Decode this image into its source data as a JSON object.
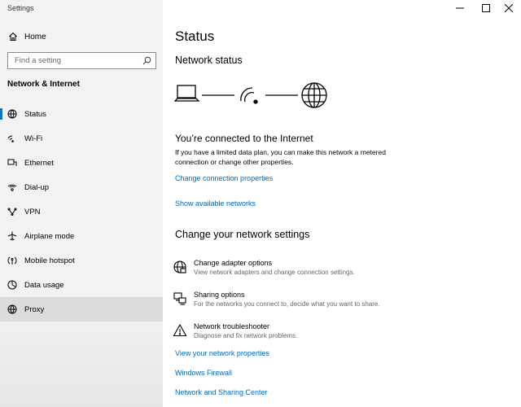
{
  "app": {
    "title": "Settings"
  },
  "sidebar": {
    "home_label": "Home",
    "search_placeholder": "Find a setting",
    "section_title": "Network & Internet",
    "items": [
      {
        "label": "Status",
        "icon": "status-icon"
      },
      {
        "label": "Wi-Fi",
        "icon": "wifi-icon"
      },
      {
        "label": "Ethernet",
        "icon": "ethernet-icon"
      },
      {
        "label": "Dial-up",
        "icon": "dialup-icon"
      },
      {
        "label": "VPN",
        "icon": "vpn-icon"
      },
      {
        "label": "Airplane mode",
        "icon": "airplane-icon"
      },
      {
        "label": "Mobile hotspot",
        "icon": "hotspot-icon"
      },
      {
        "label": "Data usage",
        "icon": "data-usage-icon"
      },
      {
        "label": "Proxy",
        "icon": "globe-icon"
      }
    ]
  },
  "main": {
    "page_title": "Status",
    "network_status": "Network status",
    "connected_title": "You’re connected to the Internet",
    "connected_desc": "If you have a limited data plan, you can make this network a metered connection or change other properties.",
    "link_change_props": "Change connection properties",
    "link_show_networks": "Show available networks",
    "change_title": "Change your network settings",
    "options": [
      {
        "title": "Change adapter options",
        "desc": "View network adapters and change connection settings.",
        "icon": "adapter-icon"
      },
      {
        "title": "Sharing options",
        "desc": "For the networks you connect to, decide what you want to share.",
        "icon": "sharing-icon"
      },
      {
        "title": "Network troubleshooter",
        "desc": "Diagnose and fix network problems.",
        "icon": "warning-icon"
      }
    ],
    "link_view_props": "View your network properties",
    "link_firewall": "Windows Firewall",
    "link_sharing_center": "Network and Sharing Center"
  },
  "colors": {
    "accent": "#0078d7",
    "link": "#0067c0",
    "sidebar_bg": "#f2f2f2",
    "hover_bg": "#dcdcdc"
  }
}
